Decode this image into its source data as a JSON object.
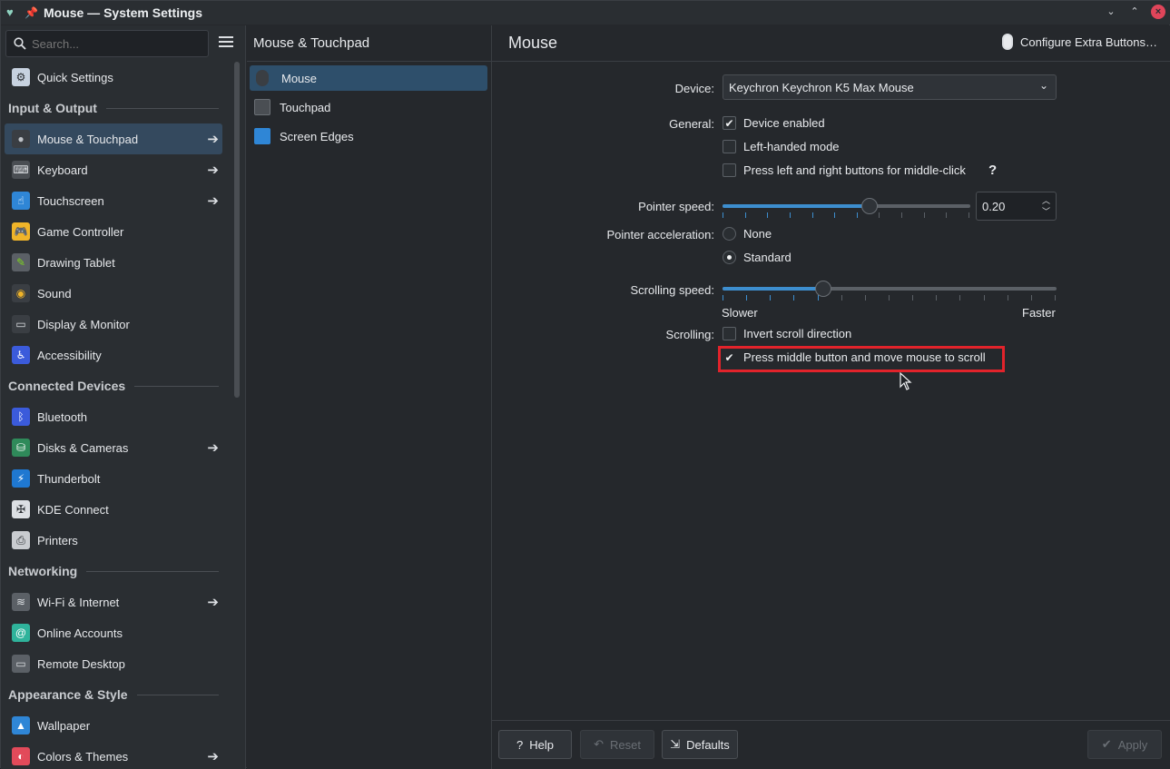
{
  "window": {
    "title": "Mouse — System Settings"
  },
  "sidebar": {
    "search_placeholder": "Search...",
    "quick_settings": "Quick Settings",
    "sections": [
      {
        "header": "Input & Output",
        "items": [
          {
            "label": "Mouse & Touchpad",
            "arrow": true,
            "selected": true
          },
          {
            "label": "Keyboard",
            "arrow": true
          },
          {
            "label": "Touchscreen",
            "arrow": true
          },
          {
            "label": "Game Controller"
          },
          {
            "label": "Drawing Tablet"
          },
          {
            "label": "Sound"
          },
          {
            "label": "Display & Monitor"
          },
          {
            "label": "Accessibility"
          }
        ]
      },
      {
        "header": "Connected Devices",
        "items": [
          {
            "label": "Bluetooth"
          },
          {
            "label": "Disks & Cameras",
            "arrow": true
          },
          {
            "label": "Thunderbolt"
          },
          {
            "label": "KDE Connect"
          },
          {
            "label": "Printers"
          }
        ]
      },
      {
        "header": "Networking",
        "items": [
          {
            "label": "Wi-Fi & Internet",
            "arrow": true
          },
          {
            "label": "Online Accounts"
          },
          {
            "label": "Remote Desktop"
          }
        ]
      },
      {
        "header": "Appearance & Style",
        "items": [
          {
            "label": "Wallpaper"
          },
          {
            "label": "Colors & Themes",
            "arrow": true
          }
        ]
      }
    ]
  },
  "middle": {
    "title": "Mouse & Touchpad",
    "items": [
      {
        "label": "Mouse",
        "selected": true
      },
      {
        "label": "Touchpad"
      },
      {
        "label": "Screen Edges"
      }
    ]
  },
  "main": {
    "title": "Mouse",
    "extra_buttons": "Configure Extra Buttons…",
    "device_label": "Device:",
    "device_value": "Keychron Keychron K5 Max Mouse",
    "general_label": "General:",
    "device_enabled": "Device enabled",
    "left_handed": "Left-handed mode",
    "middle_click": "Press left and right buttons for middle-click",
    "help_mark": "?",
    "pointer_speed_label": "Pointer speed:",
    "pointer_speed_value": "0.20",
    "pointer_speed_fraction": 0.6,
    "accel_label": "Pointer acceleration:",
    "accel_none": "None",
    "accel_standard": "Standard",
    "scroll_speed_label": "Scrolling speed:",
    "scroll_speed_fraction": 0.29,
    "slower": "Slower",
    "faster": "Faster",
    "scrolling_label": "Scrolling:",
    "invert_scroll": "Invert scroll direction",
    "middle_scroll": "Press middle button and move mouse to scroll"
  },
  "footer": {
    "help": "Help",
    "reset": "Reset",
    "defaults": "Defaults",
    "apply": "Apply"
  },
  "colors": {
    "accent": "#3d8ecf",
    "highlight": "#e2232b"
  }
}
